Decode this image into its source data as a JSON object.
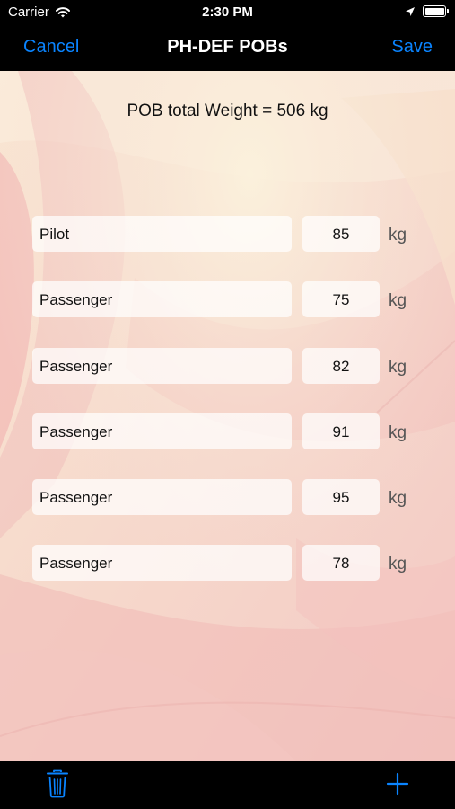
{
  "status": {
    "carrier": "Carrier",
    "time": "2:30 PM"
  },
  "nav": {
    "cancel_label": "Cancel",
    "title": "PH-DEF POBs",
    "save_label": "Save"
  },
  "summary": {
    "total_text": "POB total Weight = 506 kg"
  },
  "pobs": [
    {
      "name": "Pilot",
      "weight": "85",
      "unit": "kg"
    },
    {
      "name": "Passenger",
      "weight": "75",
      "unit": "kg"
    },
    {
      "name": "Passenger",
      "weight": "82",
      "unit": "kg"
    },
    {
      "name": "Passenger",
      "weight": "91",
      "unit": "kg"
    },
    {
      "name": "Passenger",
      "weight": "95",
      "unit": "kg"
    },
    {
      "name": "Passenger",
      "weight": "78",
      "unit": "kg"
    }
  ],
  "toolbar": {
    "delete_icon": "trash-icon",
    "add_icon": "plus-icon"
  },
  "colors": {
    "accent": "#0a84ff",
    "bar_background": "#000000",
    "content_background": "#f6d9d4"
  }
}
